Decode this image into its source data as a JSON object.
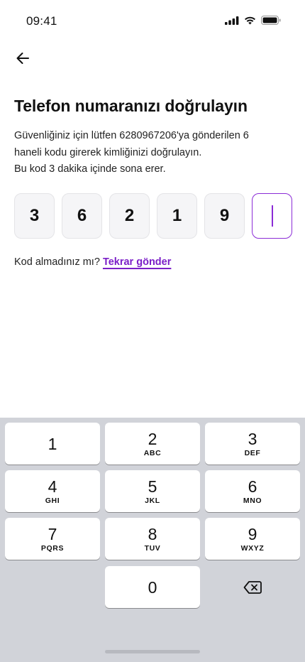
{
  "status_bar": {
    "time": "09:41"
  },
  "header": {
    "back_icon": "arrow-left-icon"
  },
  "title": "Telefon numaranızı doğrulayın",
  "description": {
    "line1": "Güvenliğiniz için lütfen 6280967206'ya gönderilen 6",
    "line2": "haneli kodu girerek kimliğinizi doğrulayın.",
    "line3": "Bu kod 3 dakika içinde sona erer."
  },
  "otp": {
    "digits": [
      "3",
      "6",
      "2",
      "1",
      "9",
      ""
    ]
  },
  "resend": {
    "prompt": "Kod almadınız mı?",
    "link": "Tekrar gönder"
  },
  "keyboard": {
    "keys": [
      {
        "num": "1",
        "letters": ""
      },
      {
        "num": "2",
        "letters": "ABC"
      },
      {
        "num": "3",
        "letters": "DEF"
      },
      {
        "num": "4",
        "letters": "GHI"
      },
      {
        "num": "5",
        "letters": "JKL"
      },
      {
        "num": "6",
        "letters": "MNO"
      },
      {
        "num": "7",
        "letters": "PQRS"
      },
      {
        "num": "8",
        "letters": "TUV"
      },
      {
        "num": "9",
        "letters": "WXYZ"
      },
      {
        "num": "0",
        "letters": ""
      }
    ],
    "delete_icon": "backspace-icon"
  },
  "colors": {
    "accent": "#8b2bd6",
    "link": "#7b1fc8",
    "keyboard_bg": "#d1d3d9"
  }
}
